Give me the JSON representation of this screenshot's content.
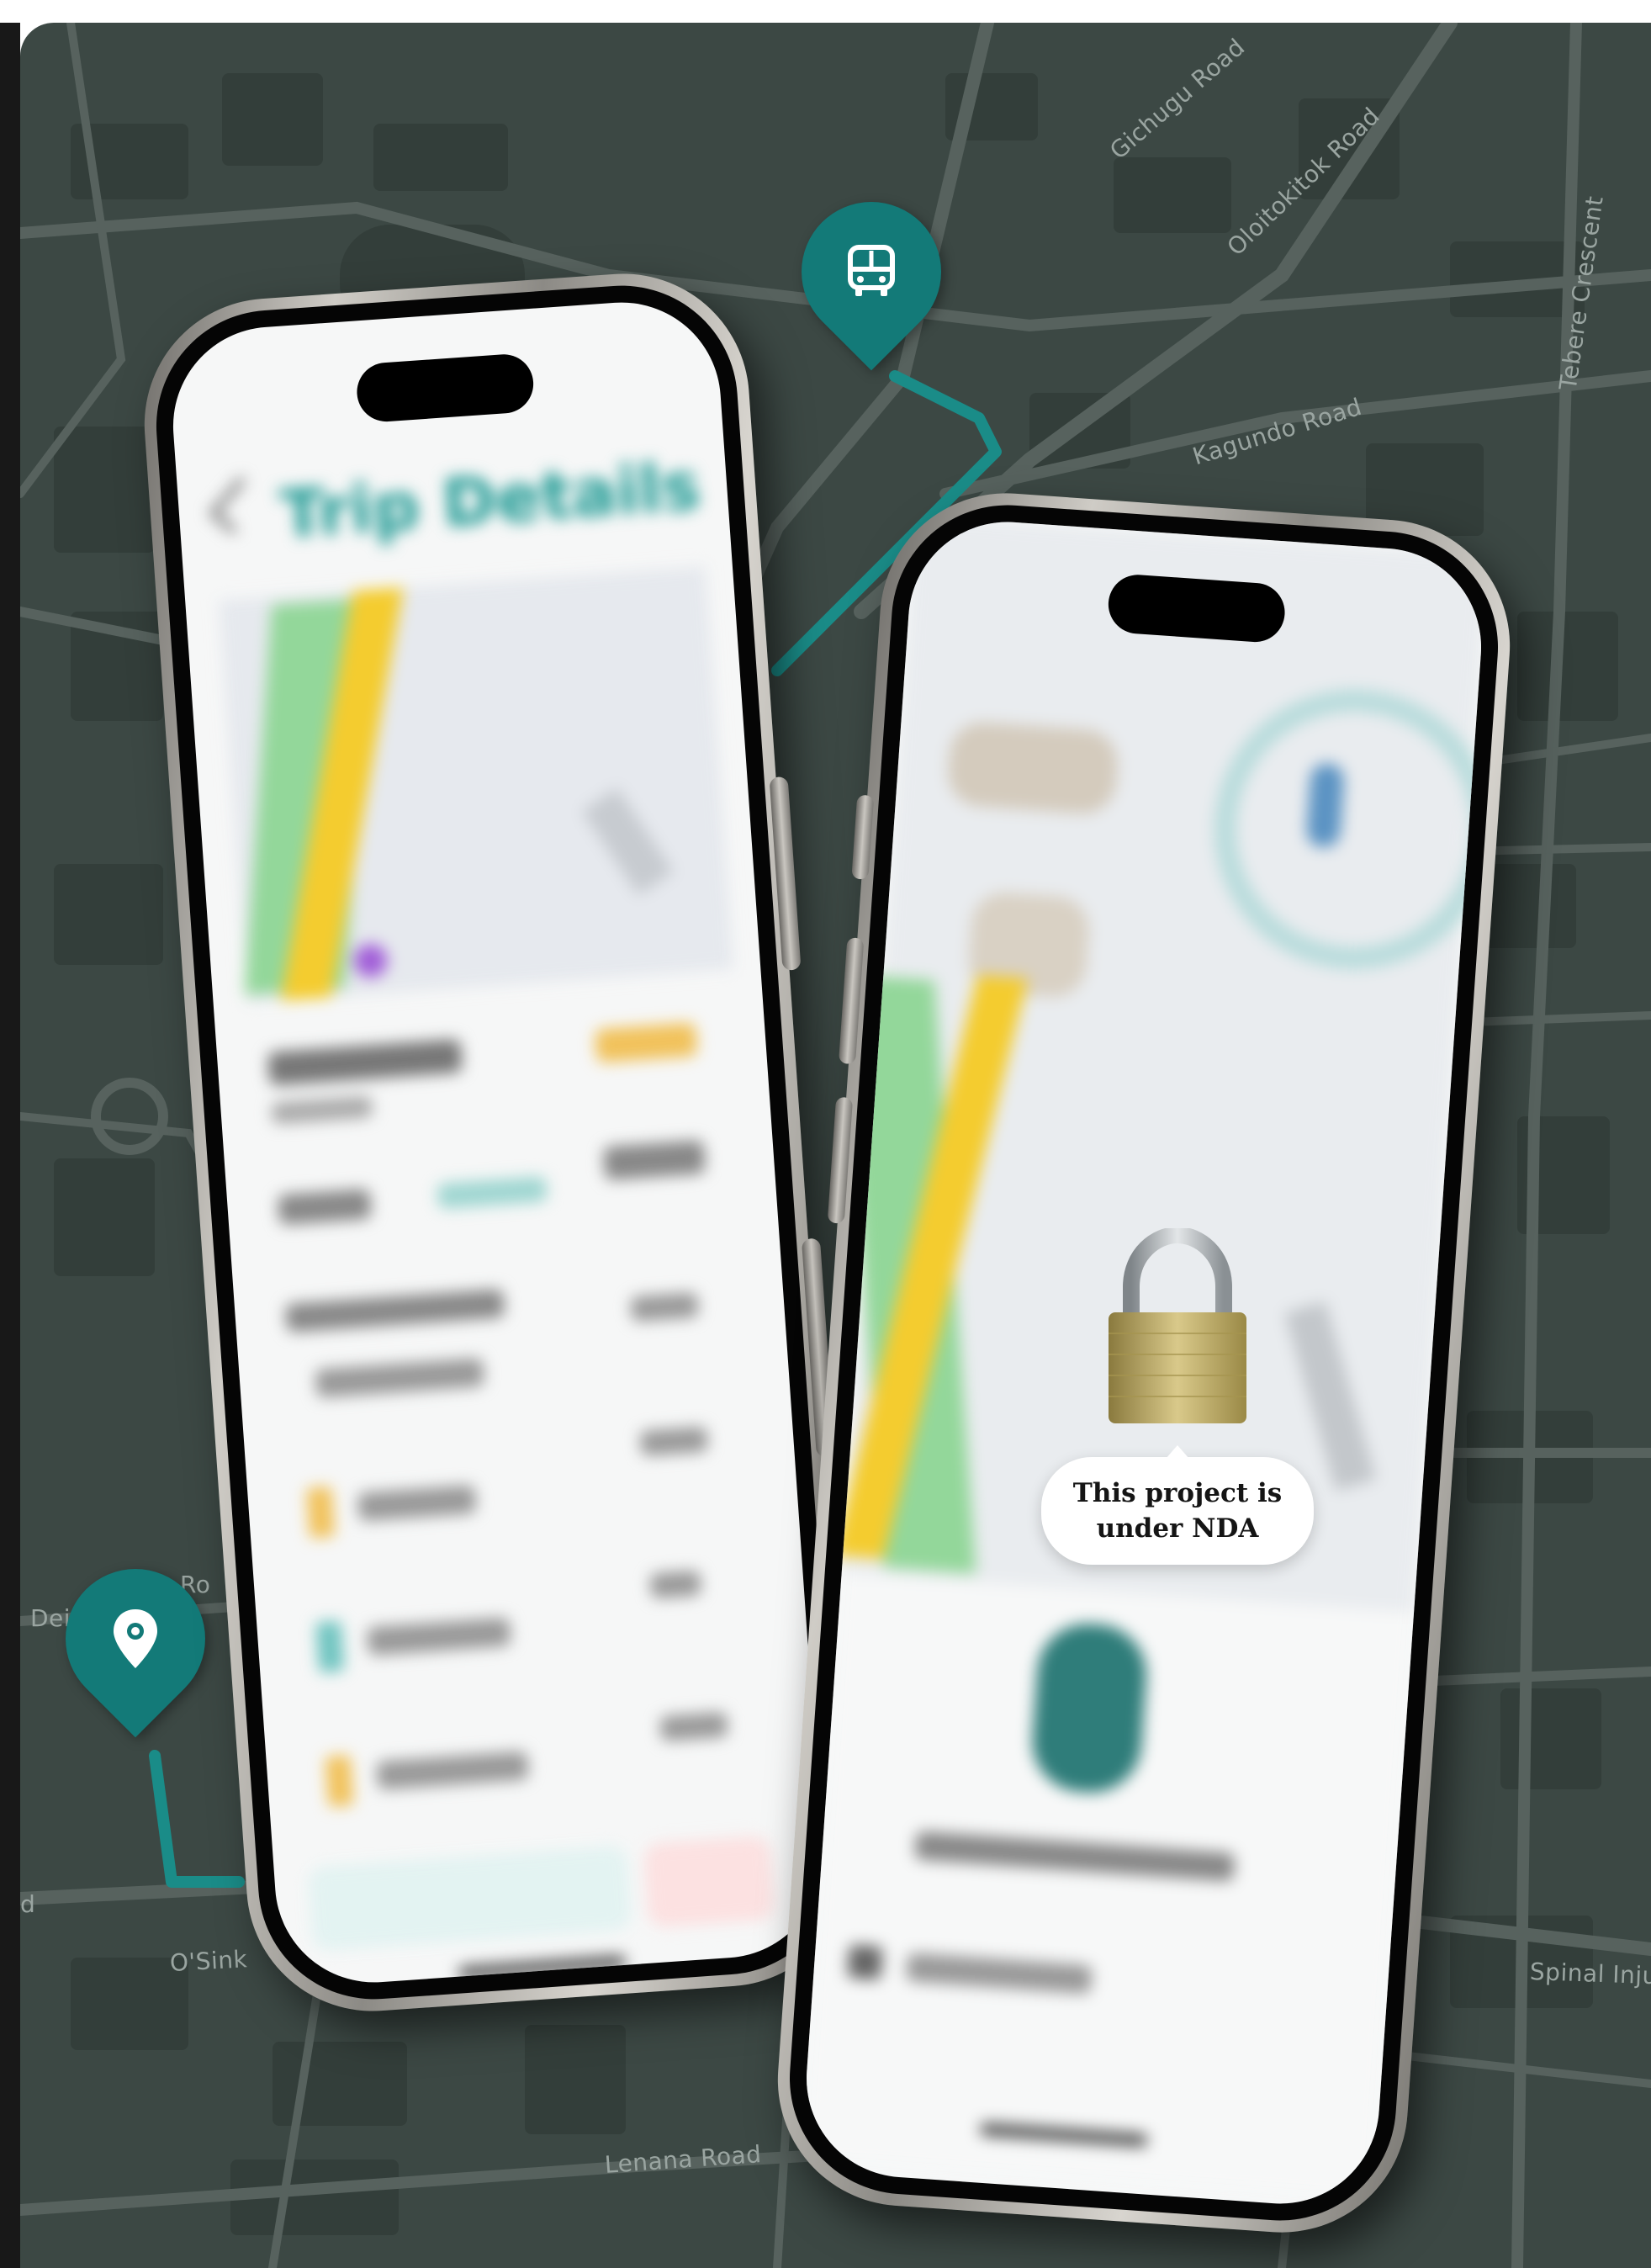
{
  "streets": {
    "gichugu": "Gichugu Road",
    "oloitokitok": "Oloitokitok Road",
    "tebere": "Tebere Crescent",
    "kagundo": "Kagundo Road",
    "lenana": "Lenana Road",
    "spinal": "Spinal Inju",
    "osink": "O'Sink",
    "dei": "Dei",
    "ro": "Ro",
    "d": "d"
  },
  "phone_left": {
    "title": "Trip Details"
  },
  "nda": {
    "line1": "This project is",
    "line2": "under NDA"
  },
  "colors": {
    "map_bg": "#3c4844",
    "road": "#57625e",
    "accent_teal": "#137a78",
    "route_line": "#1a8c88"
  },
  "icons": {
    "bus_pin": "bus-icon",
    "location_pin": "map-pin-icon",
    "lock": "lock-icon"
  }
}
